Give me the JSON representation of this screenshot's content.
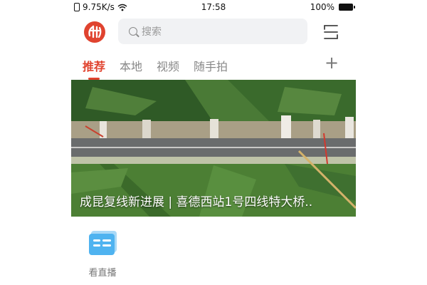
{
  "status_bar": {
    "network_speed": "9.75K/s",
    "time": "17:58",
    "battery_percent": "100%"
  },
  "header": {
    "search_placeholder": "搜索"
  },
  "tabs": [
    {
      "label": "推荐",
      "active": true
    },
    {
      "label": "本地",
      "active": false
    },
    {
      "label": "视频",
      "active": false
    },
    {
      "label": "随手拍",
      "active": false
    }
  ],
  "add_tab_symbol": "+",
  "banner": {
    "title": "成昆复线新进展 | 喜德西站1号四线特大桥.."
  },
  "shortcut": {
    "label": "看直播",
    "icon": "live-card-icon"
  },
  "colors": {
    "accent": "#e0432f",
    "shortcut_icon": "#4fb3f0"
  }
}
